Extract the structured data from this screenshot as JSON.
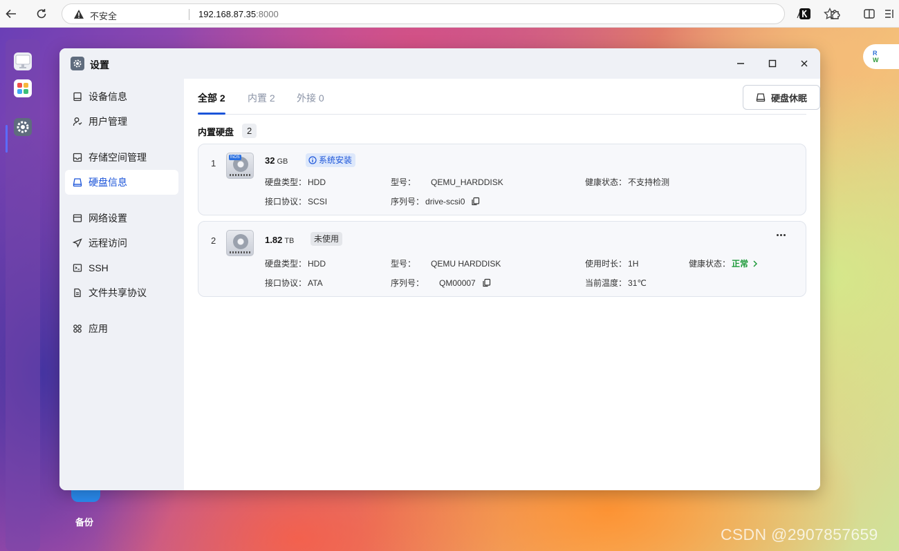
{
  "browser": {
    "insecure_label": "不安全",
    "url_host": "192.168.87.35",
    "url_port": ":8000"
  },
  "desktop": {
    "rw_badge": {
      "r": "R",
      "w": "W"
    },
    "backup_label": "备份",
    "watermark": "CSDN @2907857659"
  },
  "window": {
    "title": "设置"
  },
  "sidebar": {
    "items": [
      {
        "label": "设备信息",
        "icon": "device-icon"
      },
      {
        "label": "用户管理",
        "icon": "user-icon"
      },
      {
        "label": "存储空间管理",
        "icon": "storage-icon"
      },
      {
        "label": "硬盘信息",
        "icon": "disk-icon",
        "active": true
      },
      {
        "label": "网络设置",
        "icon": "network-icon"
      },
      {
        "label": "远程访问",
        "icon": "send-icon"
      },
      {
        "label": "SSH",
        "icon": "terminal-icon"
      },
      {
        "label": "文件共享协议",
        "icon": "file-icon"
      },
      {
        "label": "应用",
        "icon": "apps-icon"
      }
    ]
  },
  "tabs": [
    {
      "label": "全部 2",
      "active": true
    },
    {
      "label": "内置 2"
    },
    {
      "label": "外接 0"
    }
  ],
  "sleep_button": "硬盘休眠",
  "section": {
    "title": "内置硬盘",
    "count": "2"
  },
  "disks": [
    {
      "index": "1",
      "size": "32",
      "unit": "GB",
      "badge": "系统安装",
      "hdd_logo": "fnOS",
      "type_label": "硬盘类型：",
      "type": "HDD",
      "protocol_label": "接口协议：",
      "protocol": "SCSI",
      "model_label": "型号：",
      "model": "QEMU_HARDDISK",
      "serial_label": "序列号：",
      "serial": "drive-scsi0",
      "health_label": "健康状态：",
      "health": "不支持检测"
    },
    {
      "index": "2",
      "size": "1.82",
      "unit": "TB",
      "badge": "未使用",
      "type_label": "硬盘类型：",
      "type": "HDD",
      "protocol_label": "接口协议：",
      "protocol": "ATA",
      "model_label": "型号：",
      "model": "QEMU HARDDISK",
      "serial_label": "序列号：",
      "serial": "QM00007",
      "uptime_label": "使用时长：",
      "uptime": "1H",
      "temp_label": "当前温度：",
      "temp": "31℃",
      "health_label": "健康状态：",
      "health": "正常"
    }
  ],
  "colors": {
    "accent": "#1b54d9",
    "ok": "#1e9a3a",
    "sidebar_bg": "#eff1f6"
  }
}
